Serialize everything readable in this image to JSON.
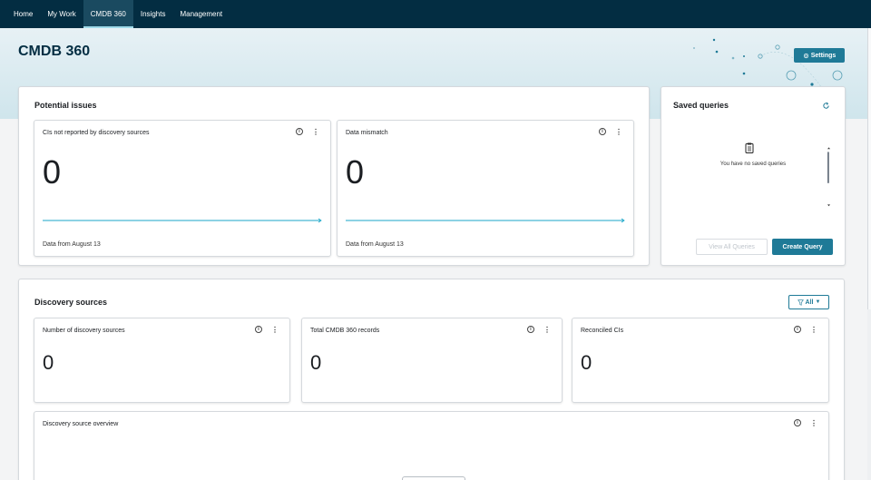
{
  "nav": {
    "items": [
      {
        "label": "Home"
      },
      {
        "label": "My Work"
      },
      {
        "label": "CMDB 360"
      },
      {
        "label": "Insights"
      },
      {
        "label": "Management"
      }
    ],
    "active": "CMDB 360"
  },
  "page": {
    "title": "CMDB 360",
    "settings_label": "Settings",
    "settings_icon": "gear-icon"
  },
  "potential_issues": {
    "title": "Potential issues",
    "tiles": [
      {
        "title": "CIs not reported by discovery sources",
        "value": "0",
        "footer": "Data from August 13"
      },
      {
        "title": "Data mismatch",
        "value": "0",
        "footer": "Data from August 13"
      }
    ]
  },
  "saved_queries": {
    "title": "Saved queries",
    "empty_text": "You have no saved queries",
    "view_all_label": "View All Queries",
    "create_label": "Create Query"
  },
  "discovery": {
    "title": "Discovery sources",
    "filter_label": "All",
    "tiles": [
      {
        "title": "Number of discovery sources",
        "value": "0"
      },
      {
        "title": "Total CMDB 360 records",
        "value": "0"
      },
      {
        "title": "Reconciled CIs",
        "value": "0"
      }
    ],
    "overview_title": "Discovery source overview"
  },
  "colors": {
    "nav_bg": "#032d42",
    "accent": "#1f7a97",
    "trend_line": "#1aa6c8"
  }
}
